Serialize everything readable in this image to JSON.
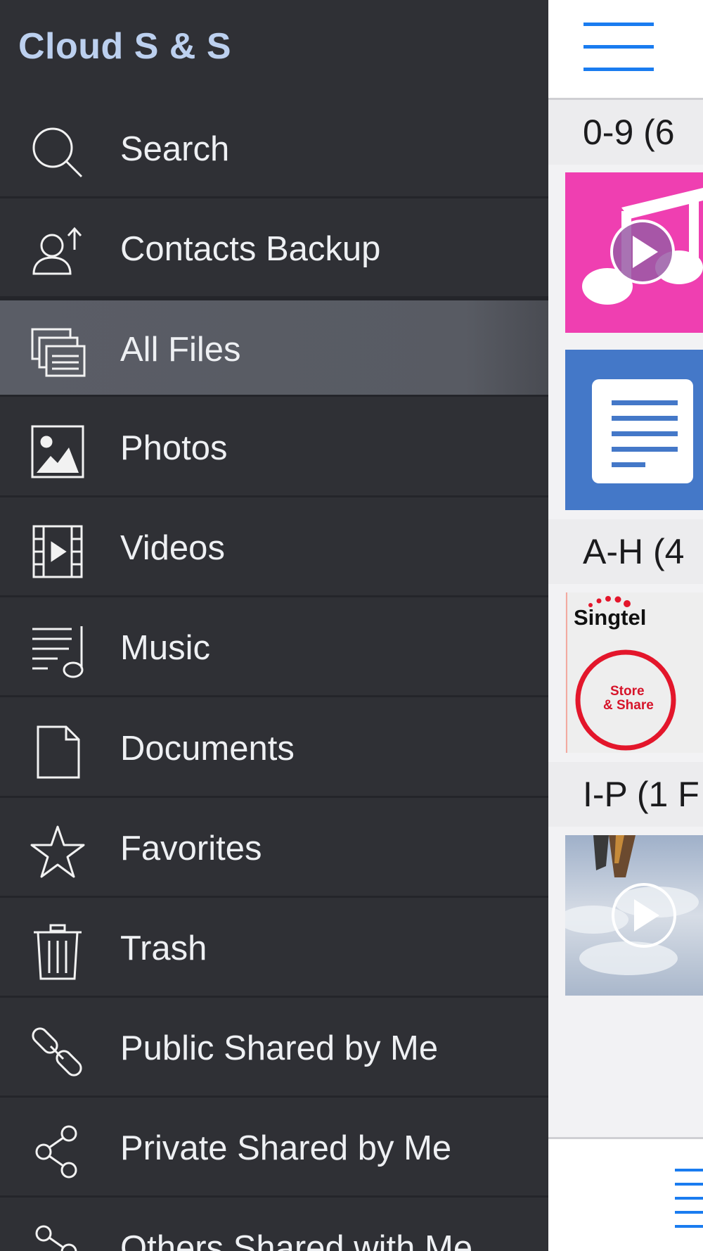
{
  "app": {
    "title": "Cloud S & S"
  },
  "drawer": {
    "items": [
      {
        "label": "Search",
        "icon": "search-icon"
      },
      {
        "label": "Contacts Backup",
        "icon": "contacts-backup-icon"
      },
      {
        "label": "All Files",
        "icon": "all-files-icon",
        "selected": true
      },
      {
        "label": "Photos",
        "icon": "photo-icon"
      },
      {
        "label": "Videos",
        "icon": "film-icon"
      },
      {
        "label": "Music",
        "icon": "music-icon"
      },
      {
        "label": "Documents",
        "icon": "document-icon"
      },
      {
        "label": "Favorites",
        "icon": "star-icon"
      },
      {
        "label": "Trash",
        "icon": "trash-icon"
      },
      {
        "label": "Public Shared by Me",
        "icon": "link-icon"
      },
      {
        "label": "Private Shared by Me",
        "icon": "share-icon"
      },
      {
        "label": "Others Shared with Me",
        "icon": "shared-with-me-icon"
      }
    ]
  },
  "main": {
    "sections": [
      {
        "header": "0-9 (6"
      },
      {
        "header": "A-H (4"
      },
      {
        "header": "I-P (1 F"
      }
    ],
    "thumbs": {
      "singtel_brand": "Singtel",
      "singtel_line1": "Store",
      "singtel_line2": "& Share"
    }
  },
  "colors": {
    "drawer_bg": "#2f3035",
    "title": "#bcd0ef",
    "accent": "#1a7cf0",
    "music_thumb": "#ef3fb1",
    "doc_thumb": "#4478c8"
  }
}
